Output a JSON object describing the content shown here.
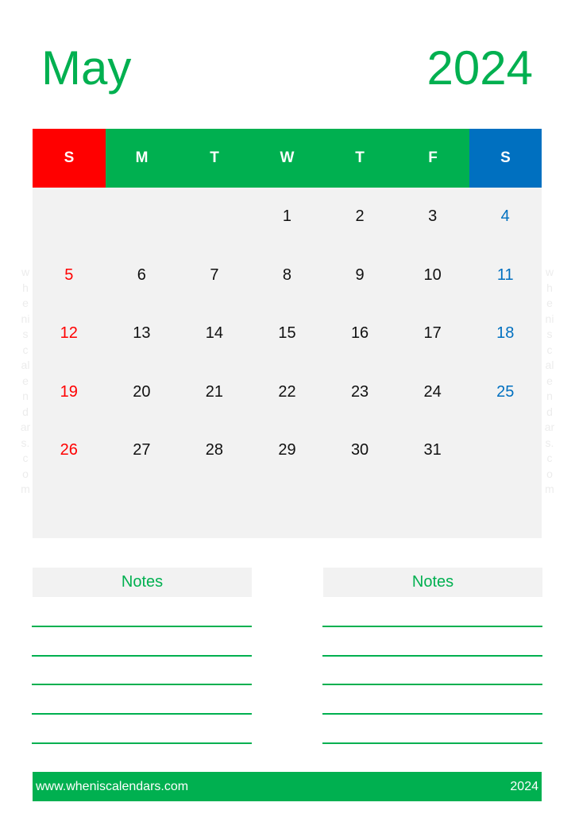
{
  "header": {
    "month": "May",
    "year": "2024"
  },
  "colors": {
    "accent": "#00b050",
    "sunday": "#ff0000",
    "saturday": "#0070c0",
    "grid_bg": "#f2f2f2"
  },
  "weekdays": [
    {
      "label": "S",
      "type": "sunday"
    },
    {
      "label": "M",
      "type": "weekday"
    },
    {
      "label": "T",
      "type": "weekday"
    },
    {
      "label": "W",
      "type": "weekday"
    },
    {
      "label": "T",
      "type": "weekday"
    },
    {
      "label": "F",
      "type": "weekday"
    },
    {
      "label": "S",
      "type": "saturday"
    }
  ],
  "weeks": [
    [
      "",
      "",
      "",
      "1",
      "2",
      "3",
      "4"
    ],
    [
      "5",
      "6",
      "7",
      "8",
      "9",
      "10",
      "11"
    ],
    [
      "12",
      "13",
      "14",
      "15",
      "16",
      "17",
      "18"
    ],
    [
      "19",
      "20",
      "21",
      "22",
      "23",
      "24",
      "25"
    ],
    [
      "26",
      "27",
      "28",
      "29",
      "30",
      "31",
      ""
    ],
    [
      "",
      "",
      "",
      "",
      "",
      "",
      ""
    ]
  ],
  "watermark": "whenis calendars.com",
  "notes": [
    {
      "title": "Notes",
      "lines": 5
    },
    {
      "title": "Notes",
      "lines": 5
    }
  ],
  "footer": {
    "website": "www.wheniscalendars.com",
    "year": "2024"
  }
}
